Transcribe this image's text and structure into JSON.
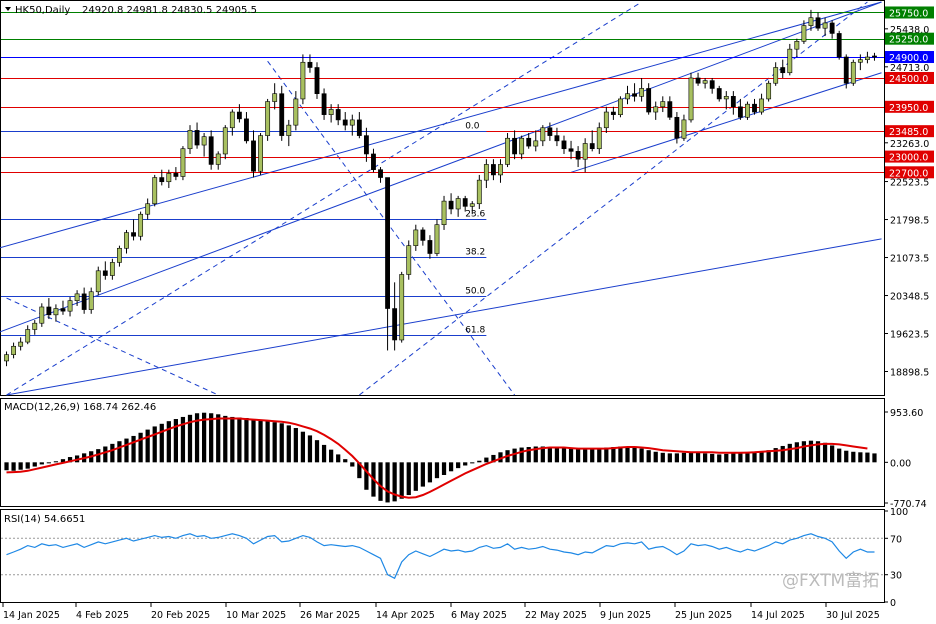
{
  "header": {
    "symbol_timeframe": "HK50,Daily",
    "ohlc": "24920.8 24981.8 24830.5 24905.5"
  },
  "watermark": "@FXTM富拓",
  "colors": {
    "bull": "#a8c060",
    "bear": "#000000",
    "support_resistance_red": "#e00000",
    "resistance_green": "#008000",
    "current_price_blue": "#0000ff",
    "trend_blue": "#1a3ecc",
    "macd_signal": "#e00000",
    "rsi": "#1e88e5"
  },
  "chart_data": [
    {
      "type": "candlestick",
      "title": "HK50,Daily",
      "ylim": [
        18450,
        25950
      ],
      "y_ticks": [
        25438.0,
        24713.0,
        23263.0,
        22523.5,
        21798.5,
        21073.5,
        20348.5,
        19623.5,
        18898.5
      ],
      "price_labels": [
        {
          "value": 25750.0,
          "label": "25750.0",
          "color": "#008000"
        },
        {
          "value": 25250.0,
          "label": "25250.0",
          "color": "#008000"
        },
        {
          "value": 24900.0,
          "label": "24900.0",
          "color": "#0000ff"
        },
        {
          "value": 24500.0,
          "label": "24500.0",
          "color": "#e00000"
        },
        {
          "value": 23950.0,
          "label": "23950.0",
          "color": "#e00000"
        },
        {
          "value": 23485.0,
          "label": "23485.0",
          "color": "#e00000"
        },
        {
          "value": 23000.0,
          "label": "23000.0",
          "color": "#e00000"
        },
        {
          "value": 22700.0,
          "label": "22700.0",
          "color": "#e00000"
        }
      ],
      "fibonacci": [
        {
          "label": "0.0",
          "value": 23485
        },
        {
          "label": "23.6",
          "value": 21810
        },
        {
          "label": "38.2",
          "value": 21080
        },
        {
          "label": "50.0",
          "value": 20330
        },
        {
          "label": "61.8",
          "value": 19600
        }
      ],
      "x_labels": [
        "14 Jan 2025",
        "4 Feb 2025",
        "20 Feb 2025",
        "10 Mar 2025",
        "26 Mar 2025",
        "14 Apr 2025",
        "6 May 2025",
        "22 May 2025",
        "9 Jun 2025",
        "25 Jun 2025",
        "14 Jul 2025",
        "30 Jul 2025"
      ],
      "candles": [
        [
          19100,
          19280,
          19000,
          19220
        ],
        [
          19220,
          19450,
          19150,
          19380
        ],
        [
          19380,
          19550,
          19300,
          19460
        ],
        [
          19460,
          19780,
          19420,
          19700
        ],
        [
          19700,
          19880,
          19600,
          19820
        ],
        [
          19820,
          20200,
          19750,
          20130
        ],
        [
          20130,
          20300,
          19900,
          19980
        ],
        [
          19980,
          20180,
          19850,
          20100
        ],
        [
          20100,
          20250,
          19980,
          20050
        ],
        [
          20050,
          20320,
          19950,
          20250
        ],
        [
          20250,
          20450,
          20150,
          20380
        ],
        [
          20380,
          20500,
          20000,
          20080
        ],
        [
          20080,
          20500,
          20000,
          20420
        ],
        [
          20420,
          20900,
          20350,
          20820
        ],
        [
          20820,
          21000,
          20650,
          20730
        ],
        [
          20730,
          21050,
          20650,
          20980
        ],
        [
          20980,
          21300,
          20900,
          21250
        ],
        [
          21250,
          21600,
          21150,
          21550
        ],
        [
          21550,
          21800,
          21400,
          21480
        ],
        [
          21480,
          21950,
          21400,
          21900
        ],
        [
          21900,
          22200,
          21800,
          22100
        ],
        [
          22100,
          22650,
          22050,
          22600
        ],
        [
          22600,
          22750,
          22450,
          22520
        ],
        [
          22520,
          22750,
          22400,
          22680
        ],
        [
          22680,
          22800,
          22550,
          22620
        ],
        [
          22620,
          23200,
          22550,
          23150
        ],
        [
          23150,
          23600,
          23050,
          23500
        ],
        [
          23500,
          23650,
          23150,
          23220
        ],
        [
          23220,
          23450,
          23000,
          23380
        ],
        [
          23380,
          23500,
          22750,
          22850
        ],
        [
          22850,
          23100,
          22750,
          23050
        ],
        [
          23050,
          23600,
          22950,
          23550
        ],
        [
          23550,
          23900,
          23400,
          23850
        ],
        [
          23850,
          24000,
          23650,
          23720
        ],
        [
          23720,
          23850,
          23250,
          23300
        ],
        [
          23300,
          23500,
          22600,
          22720
        ],
        [
          22720,
          23450,
          22650,
          23400
        ],
        [
          23400,
          24100,
          23300,
          24050
        ],
        [
          24050,
          24400,
          23900,
          24200
        ],
        [
          24200,
          24350,
          23300,
          23400
        ],
        [
          23400,
          23700,
          23200,
          23600
        ],
        [
          23600,
          24250,
          23500,
          24100
        ],
        [
          24100,
          24950,
          24000,
          24800
        ],
        [
          24800,
          24950,
          24600,
          24700
        ],
        [
          24700,
          24800,
          24100,
          24200
        ],
        [
          24200,
          24300,
          23700,
          23800
        ],
        [
          23800,
          24000,
          23650,
          23900
        ],
        [
          23900,
          24000,
          23600,
          23700
        ],
        [
          23700,
          23850,
          23500,
          23600
        ],
        [
          23600,
          23800,
          23400,
          23700
        ],
        [
          23700,
          23850,
          23350,
          23400
        ],
        [
          23400,
          23550,
          22900,
          23050
        ],
        [
          23050,
          23150,
          22700,
          22750
        ],
        [
          22750,
          22800,
          22500,
          22600
        ],
        [
          22600,
          21200,
          19300,
          20100
        ],
        [
          20100,
          20600,
          19300,
          19500
        ],
        [
          19500,
          20800,
          19450,
          20750
        ],
        [
          20750,
          21400,
          20650,
          21300
        ],
        [
          21300,
          21700,
          21200,
          21600
        ],
        [
          21600,
          21650,
          21300,
          21400
        ],
        [
          21400,
          21500,
          21050,
          21150
        ],
        [
          21150,
          21800,
          21100,
          21700
        ],
        [
          21700,
          22250,
          21600,
          22150
        ],
        [
          22150,
          22300,
          21900,
          22000
        ],
        [
          22000,
          22250,
          21850,
          22200
        ],
        [
          22200,
          22250,
          21950,
          22050
        ],
        [
          22050,
          22150,
          21900,
          22100
        ],
        [
          22100,
          22650,
          22000,
          22550
        ],
        [
          22550,
          22950,
          22400,
          22850
        ],
        [
          22850,
          22950,
          22550,
          22650
        ],
        [
          22650,
          22950,
          22500,
          22850
        ],
        [
          22850,
          23450,
          22800,
          23350
        ],
        [
          23350,
          23500,
          22950,
          23050
        ],
        [
          23050,
          23400,
          22950,
          23350
        ],
        [
          23350,
          23450,
          23150,
          23200
        ],
        [
          23200,
          23500,
          23100,
          23300
        ],
        [
          23300,
          23600,
          23200,
          23550
        ],
        [
          23550,
          23650,
          23300,
          23400
        ],
        [
          23400,
          23550,
          23200,
          23300
        ],
        [
          23300,
          23400,
          23050,
          23150
        ],
        [
          23150,
          23300,
          22950,
          23100
        ],
        [
          23100,
          23200,
          22800,
          22950
        ],
        [
          22950,
          23350,
          22700,
          23250
        ],
        [
          23250,
          23500,
          23100,
          23150
        ],
        [
          23150,
          23650,
          23050,
          23550
        ],
        [
          23550,
          23950,
          23450,
          23850
        ],
        [
          23850,
          23950,
          23700,
          23800
        ],
        [
          23800,
          24150,
          23750,
          24100
        ],
        [
          24100,
          24350,
          24000,
          24200
        ],
        [
          24200,
          24400,
          24050,
          24150
        ],
        [
          24150,
          24500,
          24050,
          24300
        ],
        [
          24300,
          24400,
          23800,
          23850
        ],
        [
          23850,
          24050,
          23700,
          23950
        ],
        [
          23950,
          24150,
          23850,
          24050
        ],
        [
          24050,
          24150,
          23700,
          23750
        ],
        [
          23750,
          23850,
          23250,
          23350
        ],
        [
          23350,
          23800,
          23300,
          23700
        ],
        [
          23700,
          24600,
          23650,
          24500
        ],
        [
          24500,
          24600,
          24350,
          24400
        ],
        [
          24400,
          24500,
          24300,
          24450
        ],
        [
          24450,
          24500,
          24200,
          24300
        ],
        [
          24300,
          24350,
          24050,
          24100
        ],
        [
          24100,
          24250,
          23900,
          24150
        ],
        [
          24150,
          24250,
          23800,
          23950
        ],
        [
          23950,
          24100,
          23700,
          23750
        ],
        [
          23750,
          24050,
          23700,
          24000
        ],
        [
          24000,
          24100,
          23800,
          23850
        ],
        [
          23850,
          24200,
          23800,
          24100
        ],
        [
          24100,
          24450,
          24050,
          24400
        ],
        [
          24400,
          24800,
          24350,
          24700
        ],
        [
          24700,
          24850,
          24500,
          24600
        ],
        [
          24600,
          25150,
          24550,
          25050
        ],
        [
          25050,
          25250,
          24900,
          25200
        ],
        [
          25200,
          25600,
          25150,
          25500
        ],
        [
          25500,
          25800,
          25400,
          25650
        ],
        [
          25650,
          25750,
          25400,
          25450
        ],
        [
          25450,
          25650,
          25300,
          25550
        ],
        [
          25550,
          25600,
          25250,
          25350
        ],
        [
          25350,
          25400,
          24850,
          24900
        ],
        [
          24900,
          24950,
          24300,
          24400
        ],
        [
          24400,
          24850,
          24350,
          24800
        ],
        [
          24800,
          24950,
          24650,
          24850
        ],
        [
          24850,
          25000,
          24780,
          24900
        ],
        [
          24920,
          24980,
          24830,
          24905
        ]
      ]
    },
    {
      "type": "bar+line",
      "title": "MACD(12,26,9) 168.74 262.46",
      "ylim": [
        -770.74,
        953.6
      ],
      "y_ticks": [
        953.6,
        0.0,
        -770.74
      ],
      "bars_series_name": "MACD",
      "signal_series_name": "Signal",
      "macd": [
        -150,
        -160,
        -140,
        -120,
        -80,
        -40,
        -10,
        20,
        60,
        100,
        130,
        170,
        210,
        250,
        300,
        350,
        400,
        450,
        500,
        560,
        620,
        680,
        730,
        780,
        820,
        860,
        900,
        930,
        940,
        930,
        910,
        880,
        860,
        850,
        840,
        820,
        800,
        780,
        760,
        740,
        700,
        650,
        580,
        510,
        420,
        330,
        240,
        150,
        60,
        -80,
        -300,
        -520,
        -650,
        -730,
        -760,
        -740,
        -690,
        -620,
        -540,
        -460,
        -380,
        -300,
        -240,
        -170,
        -110,
        -60,
        -20,
        30,
        90,
        140,
        190,
        230,
        260,
        280,
        290,
        300,
        300,
        290,
        280,
        270,
        260,
        250,
        250,
        260,
        270,
        280,
        290,
        300,
        290,
        280,
        260,
        230,
        200,
        180,
        170,
        170,
        180,
        190,
        180,
        170,
        160,
        150,
        160,
        170,
        180,
        190,
        200,
        210,
        230,
        270,
        310,
        350,
        380,
        400,
        410,
        400,
        370,
        320,
        260,
        220,
        200,
        190,
        185,
        169
      ],
      "signal": [
        -190,
        -185,
        -180,
        -160,
        -130,
        -100,
        -70,
        -40,
        -10,
        20,
        50,
        80,
        110,
        150,
        190,
        230,
        280,
        330,
        380,
        430,
        480,
        530,
        580,
        630,
        680,
        720,
        760,
        790,
        810,
        820,
        830,
        830,
        830,
        830,
        820,
        810,
        800,
        790,
        780,
        770,
        750,
        720,
        680,
        640,
        590,
        520,
        440,
        350,
        240,
        120,
        -20,
        -170,
        -320,
        -450,
        -550,
        -610,
        -650,
        -670,
        -660,
        -620,
        -560,
        -490,
        -420,
        -350,
        -280,
        -210,
        -150,
        -90,
        -30,
        20,
        70,
        120,
        160,
        200,
        230,
        250,
        270,
        280,
        280,
        280,
        270,
        260,
        260,
        260,
        260,
        260,
        270,
        280,
        290,
        290,
        280,
        270,
        250,
        230,
        220,
        210,
        200,
        190,
        190,
        190,
        190,
        180,
        180,
        180,
        180,
        185,
        190,
        200,
        210,
        220,
        230,
        250,
        270,
        300,
        320,
        340,
        350,
        350,
        340,
        320,
        300,
        280,
        262
      ]
    },
    {
      "type": "line",
      "title": "RSI(14) 54.6651",
      "ylim": [
        0,
        100
      ],
      "y_ticks": [
        100,
        70,
        30,
        0
      ],
      "series_name": "RSI",
      "rsi": [
        52,
        55,
        58,
        62,
        60,
        64,
        62,
        63,
        60,
        62,
        64,
        60,
        63,
        66,
        64,
        66,
        68,
        70,
        67,
        69,
        71,
        73,
        71,
        72,
        70,
        73,
        75,
        72,
        73,
        70,
        71,
        73,
        75,
        73,
        70,
        64,
        68,
        72,
        73,
        66,
        67,
        70,
        73,
        71,
        66,
        62,
        63,
        62,
        61,
        62,
        60,
        56,
        52,
        48,
        30,
        26,
        44,
        52,
        56,
        53,
        50,
        54,
        58,
        56,
        57,
        55,
        56,
        60,
        62,
        59,
        60,
        64,
        58,
        60,
        58,
        59,
        61,
        58,
        57,
        55,
        54,
        52,
        55,
        54,
        58,
        62,
        61,
        64,
        65,
        64,
        66,
        58,
        60,
        61,
        57,
        52,
        56,
        64,
        62,
        63,
        61,
        58,
        60,
        57,
        55,
        58,
        56,
        59,
        62,
        66,
        64,
        68,
        70,
        73,
        75,
        72,
        70,
        66,
        56,
        48,
        55,
        58,
        55,
        55
      ]
    }
  ]
}
